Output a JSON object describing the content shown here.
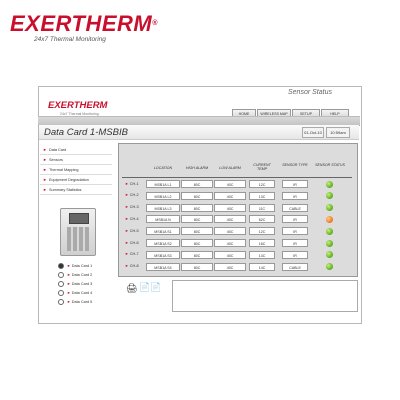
{
  "brand": {
    "name": "EXERTHERM",
    "registered": "®",
    "tagline": "24x7 Thermal Monitoring"
  },
  "window": {
    "logo": "EXERTHERM",
    "logo_tagline": "24x7 Thermal Monitoring",
    "section_title": "Sensor Status",
    "nav": [
      "HOME",
      "WIRELESS MAP",
      "SETUP",
      "HELP"
    ],
    "page_title": "Data Card 1-MSBIB",
    "date": "01-Oct-10",
    "time": "10:59am"
  },
  "sidebar": {
    "items": [
      "Data Card",
      "Sensors",
      "Thermal Mapping",
      "Equipment Degradation",
      "Summary Statistics"
    ]
  },
  "datacards": {
    "items": [
      "Data Card 1",
      "Data Card 2",
      "Data Card 3",
      "Data Card 4",
      "Data Card 5"
    ],
    "selected": 0
  },
  "table": {
    "headers": [
      "LOCATION",
      "HIGH ALARM",
      "LOW ALARM",
      "CURRENT TEMP",
      "SENSOR TYPE",
      "SENSOR STATUS"
    ],
    "rows": [
      {
        "ch": "CH-1",
        "location": "MSB1A L1",
        "high": "80C",
        "low": "40C",
        "current": "12C",
        "type": "IR",
        "status": "green"
      },
      {
        "ch": "CH-2",
        "location": "MSB1A L2",
        "high": "80C",
        "low": "40C",
        "current": "13C",
        "type": "IR",
        "status": "green"
      },
      {
        "ch": "CH-3",
        "location": "MSB1A L3",
        "high": "80C",
        "low": "40C",
        "current": "11C",
        "type": "CABLE",
        "status": "green"
      },
      {
        "ch": "CH-4",
        "location": "MSB1A N",
        "high": "80C",
        "low": "40C",
        "current": "62C",
        "type": "IR",
        "status": "orange"
      },
      {
        "ch": "CH-5",
        "location": "MSB1A S1",
        "high": "80C",
        "low": "40C",
        "current": "12C",
        "type": "IR",
        "status": "green"
      },
      {
        "ch": "CH-6",
        "location": "MSB1A S2",
        "high": "80C",
        "low": "40C",
        "current": "16C",
        "type": "IR",
        "status": "green"
      },
      {
        "ch": "CH-7",
        "location": "MSB1A S3",
        "high": "80C",
        "low": "40C",
        "current": "13C",
        "type": "IR",
        "status": "green"
      },
      {
        "ch": "CH-8",
        "location": "MSB1A S4",
        "high": "80C",
        "low": "40C",
        "current": "14C",
        "type": "CABLE",
        "status": "green"
      }
    ]
  },
  "icons": {
    "print": "printer-icon",
    "excel": "excel-icon",
    "pdf": "pdf-icon"
  },
  "colors": {
    "brand_red": "#c8102e",
    "ok": "#5aaa1e",
    "warn": "#e8731a"
  }
}
